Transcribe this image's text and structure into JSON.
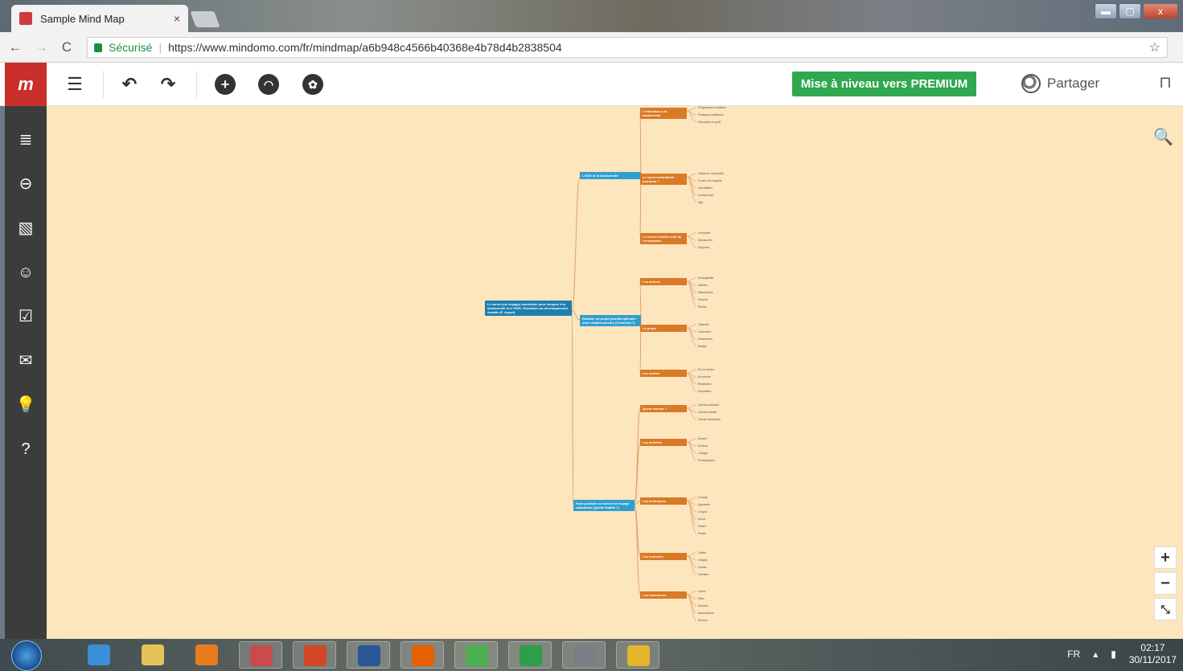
{
  "browser": {
    "tab_title": "Sample Mind Map",
    "tab_close": "×",
    "secure_label": "Sécurisé",
    "url": "https://www.mindomo.com/fr/mindmap/a6b948c4566b40368e4b78d4b2838504",
    "back": "←",
    "forward": "→",
    "reload": "C",
    "star": "☆"
  },
  "window_buttons": {
    "minimize": "▬",
    "maximize": "▢",
    "close": "x"
  },
  "toolbar": {
    "menu_icon": "☰",
    "undo_icon": "↶",
    "redo_icon": "↷",
    "add_icon": "+",
    "premium_label": "Mise à niveau vers PREMIUM",
    "share_label": "Partager"
  },
  "canvas": {
    "search_icon": "🔍",
    "zoom_in": "+",
    "zoom_out": "−",
    "fit": "⤡"
  },
  "mindmap": {
    "root": "Le carnet (de voyage) naturaliste pour éduquer à la biodiversité et à l'EDD, Education au développement durable (F. Argod)",
    "branches": [
      {
        "label": "L'EDD et la biodiversité",
        "color": "blue",
        "subs": [
          {
            "label": "L'éducation à la biodiversité",
            "leaves": [
              "Programmes scolaires",
              "Pratiques artistiques",
              "Education au goût"
            ]
          },
          {
            "label": "Le carnet naturaliste : pourquoi ?",
            "leaves": [
              "Observer, interpréter",
              "Croiser les regards",
              "Sensibiliser",
              "Comprendre",
              "Agir"
            ]
          },
          {
            "label": "Le carnet comme outil de l'enseignant",
            "leaves": [
              "Exemples",
              "Démarches",
              "Supports"
            ]
          }
        ]
      },
      {
        "label": "Réaliser un projet pluridisciplinaire entre établissements (Comment ?)",
        "color": "blue",
        "subs": [
          {
            "label": "Les acteurs",
            "leaves": [
              "Enseignants",
              "Artistes",
              "Naturalistes",
              "Parents",
              "Élèves"
            ]
          },
          {
            "label": "Le projet",
            "leaves": [
              "Objectifs",
              "Calendrier",
              "Partenaires",
              "Budget"
            ]
          },
          {
            "label": "Les sorties",
            "leaves": [
              "Sur le terrain",
              "Au musée",
              "Restitution",
              "Exposition"
            ]
          }
        ]
      },
      {
        "label": "Faire produire un carnet de voyage naturaliste (Quelle finalité ?)",
        "color": "blue",
        "subs": [
          {
            "label": "Quels carnets ?",
            "leaves": [
              "Carnet individuel",
              "Carnet collectif",
              "Carnet numérique"
            ]
          },
          {
            "label": "Les activités",
            "leaves": [
              "Dessin",
              "Écriture",
              "Collage",
              "Photographie"
            ]
          },
          {
            "label": "Les techniques",
            "leaves": [
              "Croquis",
              "Aquarelle",
              "Crayon",
              "Encre",
              "Pastel",
              "Feutre"
            ]
          },
          {
            "label": "Les contenus",
            "leaves": [
              "Textes",
              "Images",
              "Cartes",
              "Herbiers"
            ]
          },
          {
            "label": "Les ressources",
            "leaves": [
              "Livres",
              "Sites",
              "Musées",
              "Associations",
              "Revues"
            ]
          }
        ]
      }
    ]
  },
  "sidebar": {
    "items": [
      {
        "name": "outline-icon",
        "glyph": "≣"
      },
      {
        "name": "link-icon",
        "glyph": "⊖"
      },
      {
        "name": "image-icon",
        "glyph": "▧"
      },
      {
        "name": "emoji-icon",
        "glyph": "☺"
      },
      {
        "name": "tasks-icon",
        "glyph": "☑"
      },
      {
        "name": "comments-icon",
        "glyph": "✉"
      },
      {
        "name": "idea-icon",
        "glyph": "💡"
      },
      {
        "name": "help-icon",
        "glyph": "?"
      }
    ]
  },
  "taskbar": {
    "language": "FR",
    "time": "02:17",
    "date": "30/11/2017",
    "apps": [
      {
        "name": "ie-icon",
        "color": "#3a8fd6"
      },
      {
        "name": "explorer-icon",
        "color": "#e6c35a"
      },
      {
        "name": "media-icon",
        "color": "#e87b1e"
      },
      {
        "name": "paint-icon",
        "color": "#c94b4b"
      },
      {
        "name": "powerpoint-icon",
        "color": "#d24726"
      },
      {
        "name": "word-icon",
        "color": "#2b5797"
      },
      {
        "name": "firefox-icon",
        "color": "#e66000"
      },
      {
        "name": "chrome-icon",
        "color": "#4caf50"
      },
      {
        "name": "hp-icon",
        "color": "#2f9e4a"
      },
      {
        "name": "laptop-icon",
        "color": "#7a7f86"
      },
      {
        "name": "security-icon",
        "color": "#e3b52a"
      }
    ]
  }
}
